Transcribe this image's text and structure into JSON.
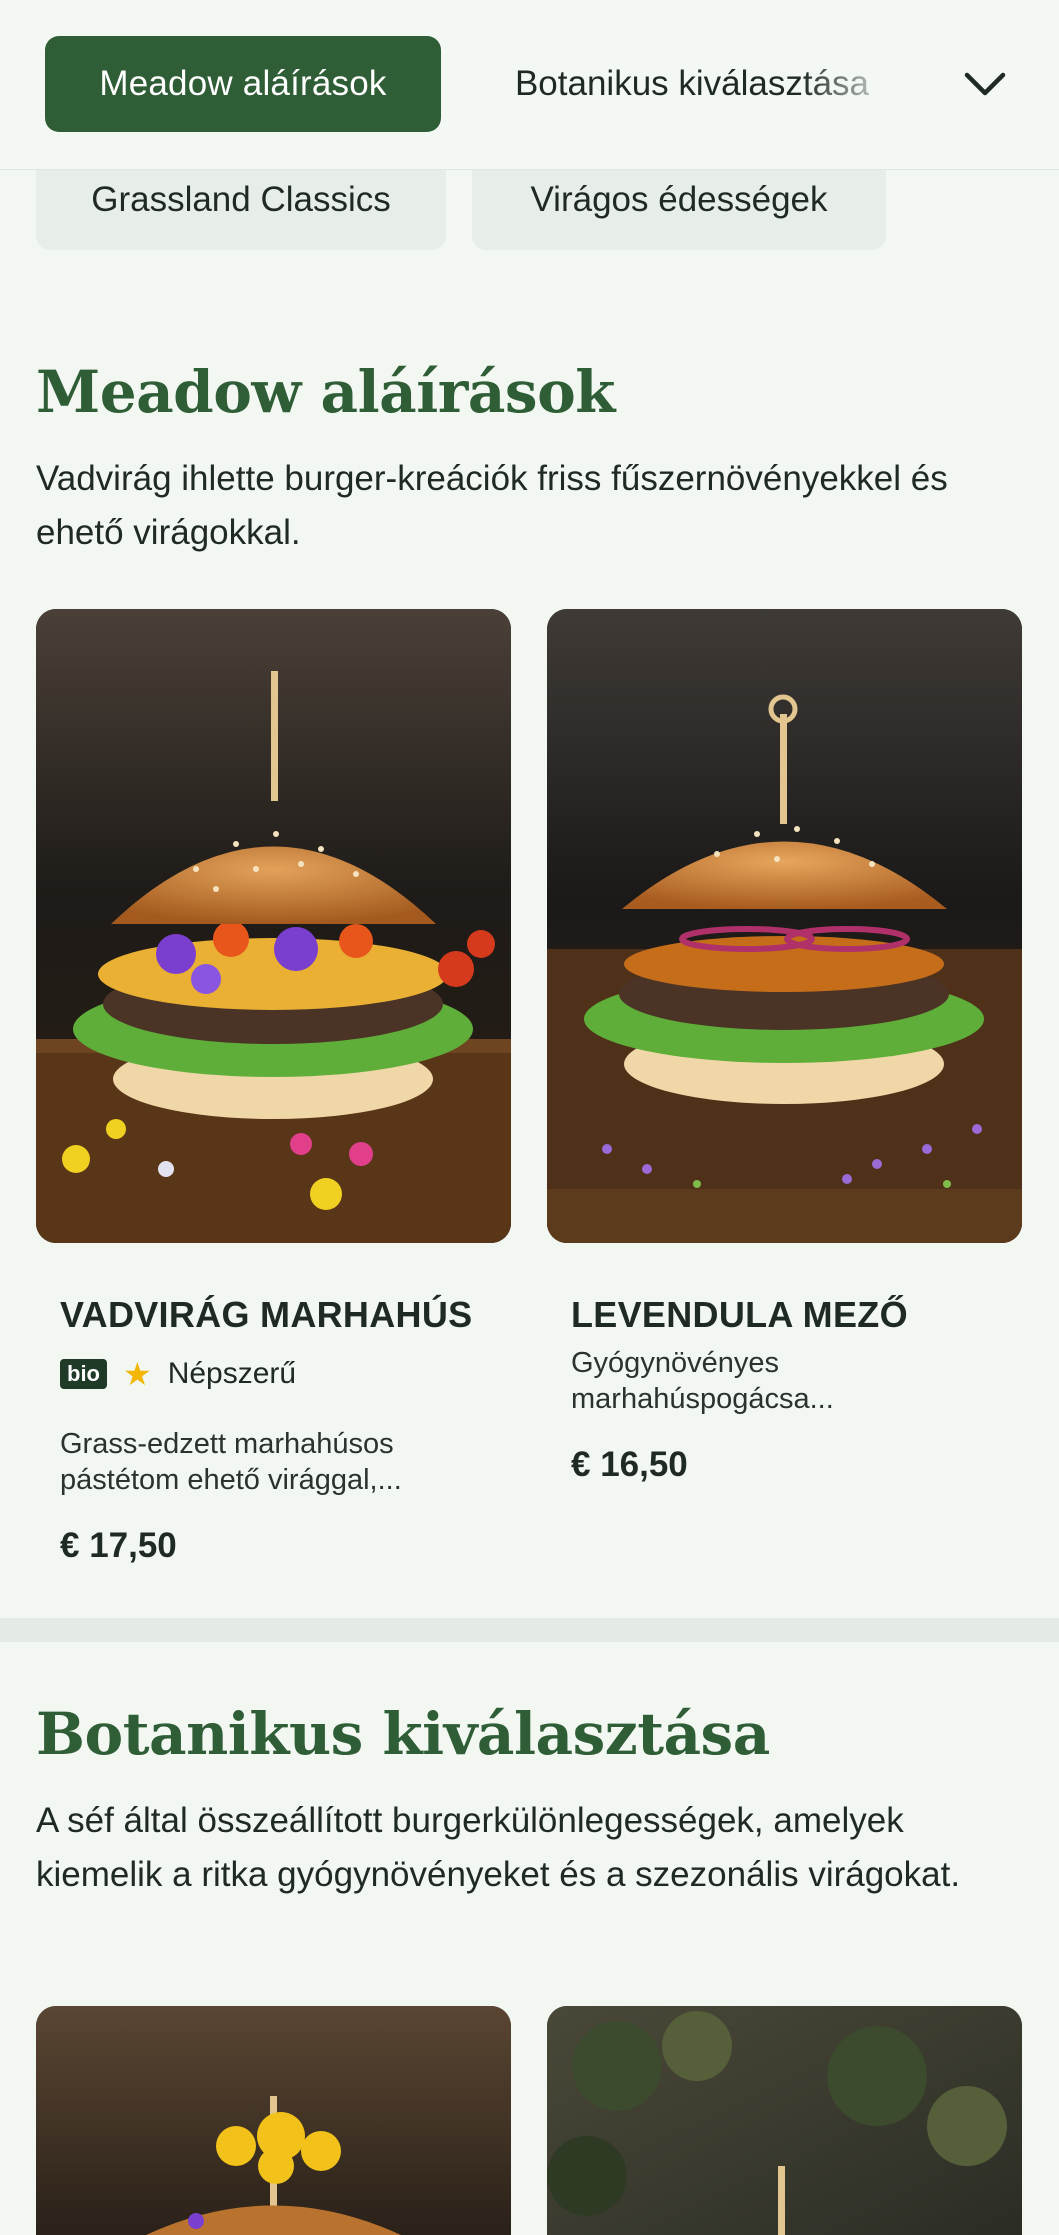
{
  "nav": {
    "tabs": [
      {
        "label": "Meadow aláírások",
        "active": true
      },
      {
        "label": "Botanikus kiválasztása",
        "active": false
      }
    ],
    "more_icon": "chevron-down-icon",
    "chips": [
      {
        "label": "Grassland Classics"
      },
      {
        "label": "Virágos édességek"
      }
    ]
  },
  "sections": [
    {
      "title": "Meadow aláírások",
      "description": "Vadvirág ihlette burger-kreációk friss fűszernövényekkel és ehető virágokkal.",
      "items": [
        {
          "name": "VADVIRÁG MARHAHÚS",
          "badge": "bio",
          "popular_label": "Népszerű",
          "description": "Grass-edzett marhahúsos pástétom ehető virággal,...",
          "price": "€ 17,50"
        },
        {
          "name": "LEVENDULA MEZŐ",
          "description": "Gyógynövényes marhahúspogácsa...",
          "price": "€ 16,50"
        }
      ]
    },
    {
      "title": "Botanikus kiválasztása",
      "description": "A séf által összeállított burgerkülönlegességek, amelyek kiemelik a ritka gyógynövényeket és a szezonális virágokat."
    }
  ],
  "colors": {
    "brand_green": "#2e5d36",
    "background": "#f2f7f2",
    "star": "#f2b705"
  }
}
